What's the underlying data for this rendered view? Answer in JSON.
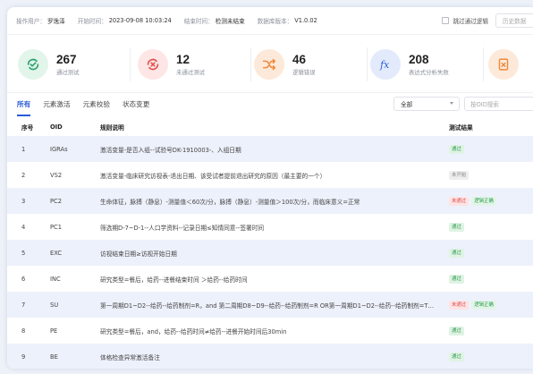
{
  "meta": {
    "operator_label": "操作用户：",
    "operator": "罗逸泽",
    "start_label": "开始时间：",
    "start": "2023-09-08 10:03:24",
    "end_label": "结束时间：",
    "end": "检测未结束",
    "version_label": "数据库版本：",
    "version": "V1.0.02",
    "skip_label": "跳过通过逻辑",
    "history_label": "历史数据"
  },
  "stats": [
    {
      "value": "267",
      "label": "通过测试",
      "icon": "check-refresh-icon",
      "color": "#2aa36a",
      "bg": "#e2f5ea"
    },
    {
      "value": "12",
      "label": "未通过测试",
      "icon": "x-refresh-icon",
      "color": "#e0524f",
      "bg": "#fde6e5"
    },
    {
      "value": "46",
      "label": "逻辑错误",
      "icon": "shuffle-icon",
      "color": "#ef8a3c",
      "bg": "#fde9d9"
    },
    {
      "value": "208",
      "label": "表达式分析失败",
      "icon": "fx-icon",
      "color": "#2b5bd7",
      "bg": "#e2eafb"
    },
    {
      "value": "",
      "label": "",
      "icon": "file-x-icon",
      "color": "#ef8a3c",
      "bg": "#fde9d9"
    }
  ],
  "tabs": [
    "所有",
    "元素激活",
    "元素校验",
    "状态变更"
  ],
  "filter": {
    "selected": "全部",
    "search_placeholder": "按OID搜索"
  },
  "table": {
    "headers": [
      "序号",
      "OID",
      "规则说明",
      "测试结果"
    ],
    "rows": [
      {
        "no": "1",
        "oid": "IGRAs",
        "rule": "激活变量-是否入组--试验号DK-1910003-、入组日期",
        "results": [
          {
            "text": "通过",
            "type": "pass"
          }
        ]
      },
      {
        "no": "2",
        "oid": "VS2",
        "rule": "激活变量-临床研究访视表-退出日期、该受试者提前退出研究的原因（最主要的一个）",
        "results": [
          {
            "text": "未开始",
            "type": "none"
          }
        ]
      },
      {
        "no": "3",
        "oid": "PC2",
        "rule": "生命体征，脉搏（静息）-测量值＜60次/分，脉搏（静息）-测量值＞100次/分，而临床意义=正常",
        "results": [
          {
            "text": "未通过",
            "type": "fail"
          },
          {
            "text": "逻辑正确",
            "type": "ok"
          }
        ]
      },
      {
        "no": "4",
        "oid": "PC1",
        "rule": "筛选期D-7~D-1--人口学资料--记录日期≤知情同意--签署时间",
        "results": [
          {
            "text": "通过",
            "type": "pass"
          }
        ]
      },
      {
        "no": "5",
        "oid": "EXC",
        "rule": "访视结束日期≥访视开始日期",
        "results": [
          {
            "text": "通过",
            "type": "pass"
          }
        ]
      },
      {
        "no": "6",
        "oid": "INC",
        "rule": "研究类型=餐后，给药--进餐结束时间 ＞给药--给药时间",
        "results": [
          {
            "text": "通过",
            "type": "pass"
          }
        ]
      },
      {
        "no": "7",
        "oid": "SU",
        "rule": "第一周期D1~D2--给药--给药制剂=R，and 第二周期D8~D9--给药--给药制剂=R OR第一周期D1~D2--给药--给药制剂=T…",
        "results": [
          {
            "text": "未通过",
            "type": "fail"
          },
          {
            "text": "逻辑正确",
            "type": "ok"
          }
        ]
      },
      {
        "no": "8",
        "oid": "PE",
        "rule": "研究类型=餐后，and，给药--给药时间≠给药--进餐开始时间后30min",
        "results": [
          {
            "text": "通过",
            "type": "pass"
          }
        ]
      },
      {
        "no": "9",
        "oid": "BE",
        "rule": "体格检查异常激活备注",
        "results": [
          {
            "text": "通过",
            "type": "pass"
          }
        ]
      }
    ]
  }
}
